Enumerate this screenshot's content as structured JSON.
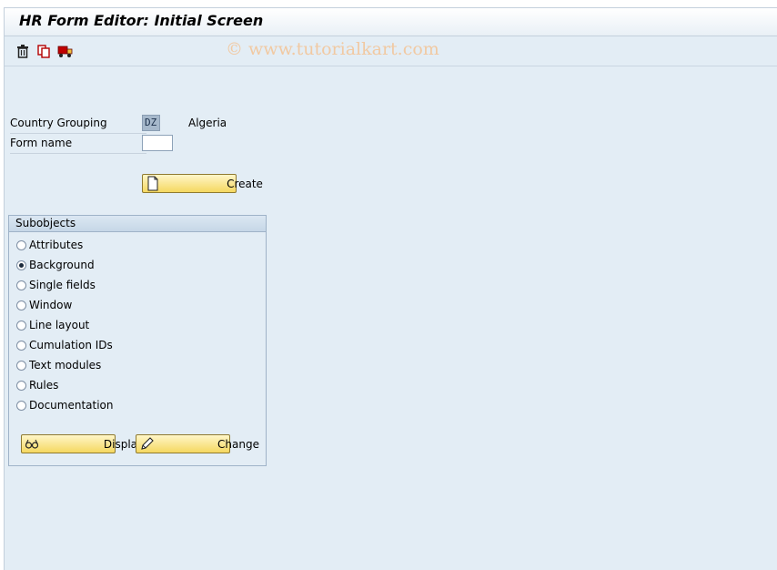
{
  "window": {
    "title": "HR Form Editor: Initial Screen",
    "watermark": "© www.tutorialkart.com"
  },
  "toolbar": {
    "items": [
      {
        "name": "delete",
        "icon": "trash-icon"
      },
      {
        "name": "copy",
        "icon": "copy-icon"
      },
      {
        "name": "transport",
        "icon": "truck-icon"
      }
    ]
  },
  "form": {
    "country_label": "Country Grouping",
    "country_value": "DZ",
    "country_text": "Algeria",
    "form_name_label": "Form name",
    "form_name_value": "",
    "create_label": "Create"
  },
  "subobjects": {
    "title": "Subobjects",
    "selected": "Background",
    "options": [
      "Attributes",
      "Background",
      "Single fields",
      "Window",
      "Line layout",
      "Cumulation IDs",
      "Text modules",
      "Rules",
      "Documentation"
    ],
    "display_label": "Display",
    "change_label": "Change"
  },
  "colors": {
    "background": "#e3edf5",
    "button_yellow": "#f5d860",
    "key_field": "#a6b8cb"
  }
}
